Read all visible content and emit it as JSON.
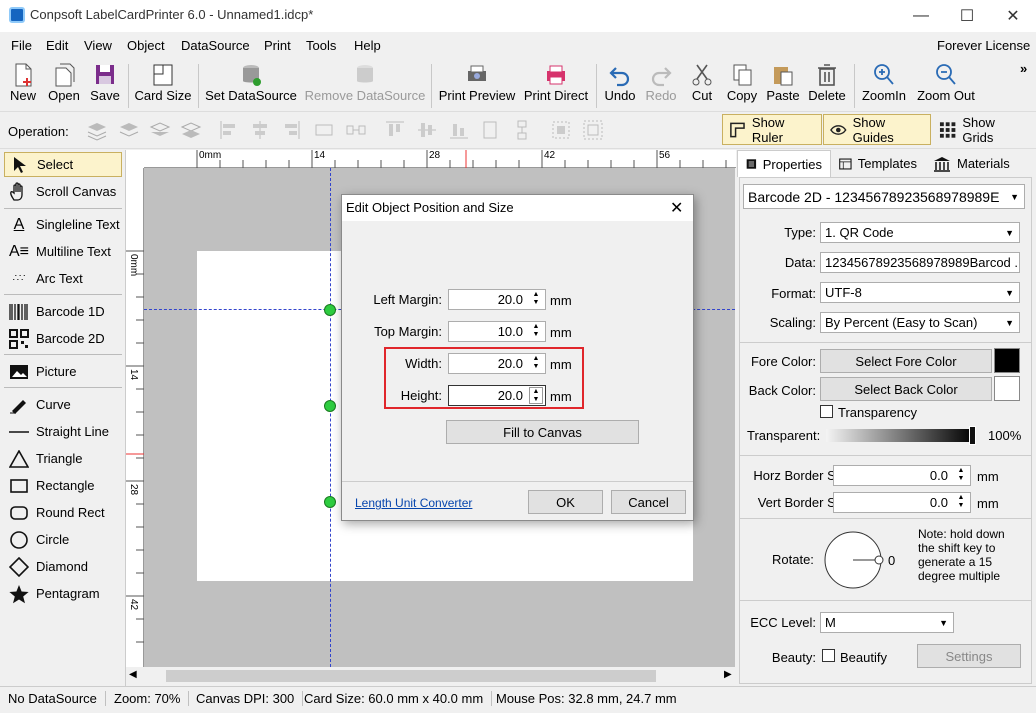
{
  "window": {
    "title": "Conpsoft LabelCardPrinter 6.0 - Unnamed1.idcp*",
    "minimize": "—",
    "maximize": "☐",
    "close": "✕"
  },
  "menu": {
    "items": [
      "File",
      "Edit",
      "View",
      "Object",
      "DataSource",
      "Print",
      "Tools",
      "Help"
    ],
    "license": "Forever License"
  },
  "toolbar": {
    "new": "New",
    "open": "Open",
    "save": "Save",
    "card_size": "Card Size",
    "set_datasource": "Set DataSource",
    "remove_datasource": "Remove DataSource",
    "print_preview": "Print Preview",
    "print_direct": "Print Direct",
    "undo": "Undo",
    "redo": "Redo",
    "cut": "Cut",
    "copy": "Copy",
    "paste": "Paste",
    "delete": "Delete",
    "zoom_in": "ZoomIn",
    "zoom_out": "Zoom Out",
    "overflow": "»"
  },
  "opbar": {
    "label": "Operation:",
    "show_ruler": "Show Ruler",
    "show_guides": "Show Guides",
    "show_grids": "Show Grids"
  },
  "tools": {
    "select": "Select",
    "scroll_canvas": "Scroll Canvas",
    "singleline_text": "Singleline Text",
    "multiline_text": "Multiline Text",
    "arc_text": "Arc Text",
    "barcode_1d": "Barcode 1D",
    "barcode_2d": "Barcode 2D",
    "picture": "Picture",
    "curve": "Curve",
    "straight_line": "Straight Line",
    "triangle": "Triangle",
    "rectangle": "Rectangle",
    "round_rect": "Round Rect",
    "circle": "Circle",
    "diamond": "Diamond",
    "pentagram": "Pentagram"
  },
  "ruler": {
    "h_labels": [
      "0mm",
      "14",
      "28",
      "42",
      "56"
    ],
    "v_labels": [
      "0mm",
      "14",
      "28",
      "42"
    ]
  },
  "dialog": {
    "title": "Edit Object Position and Size",
    "left_margin_label": "Left Margin:",
    "left_margin": "20.0",
    "top_margin_label": "Top Margin:",
    "top_margin": "10.0",
    "width_label": "Width:",
    "width": "20.0",
    "height_label": "Height:",
    "height": "20.0",
    "unit": "mm",
    "fill_to_canvas": "Fill to Canvas",
    "link": "Length Unit Converter",
    "ok": "OK",
    "cancel": "Cancel"
  },
  "right": {
    "tabs": {
      "properties": "Properties",
      "templates": "Templates",
      "materials": "Materials"
    },
    "object_combo": "Barcode 2D - 12345678923568978989E",
    "type_label": "Type:",
    "type_value": "1.  QR Code",
    "data_label": "Data:",
    "data_value": "12345678923568978989Barcod ...",
    "format_label": "Format:",
    "format_value": "UTF-8",
    "scaling_label": "Scaling:",
    "scaling_value": "By Percent (Easy to Scan)",
    "fore_color_label": "Fore Color:",
    "fore_color_btn": "Select Fore Color",
    "fore_color": "#000000",
    "back_color_label": "Back Color:",
    "back_color_btn": "Select Back Color",
    "back_color": "#ffffff",
    "transparency": "Transparency",
    "transparent_label": "Transparent:",
    "transparent_value": "100%",
    "horz_border_label": "Horz Border Size:",
    "horz_border_value": "0.0",
    "vert_border_label": "Vert Border Size:",
    "vert_border_value": "0.0",
    "unit": "mm",
    "rotate_label": "Rotate:",
    "rotate_value": "0",
    "note": "Note: hold down the shift key to generate a 15 degree multiple",
    "ecc_label": "ECC Level:",
    "ecc_value": "M",
    "beauty_label": "Beauty:",
    "beautify": "Beautify",
    "settings": "Settings"
  },
  "status": {
    "datasource": "No DataSource",
    "zoom": "Zoom: 70%",
    "dpi": "Canvas DPI: 300",
    "card_size": "Card Size: 60.0 mm x 40.0 mm",
    "mouse_pos": "Mouse Pos: 32.8 mm, 24.7 mm"
  }
}
